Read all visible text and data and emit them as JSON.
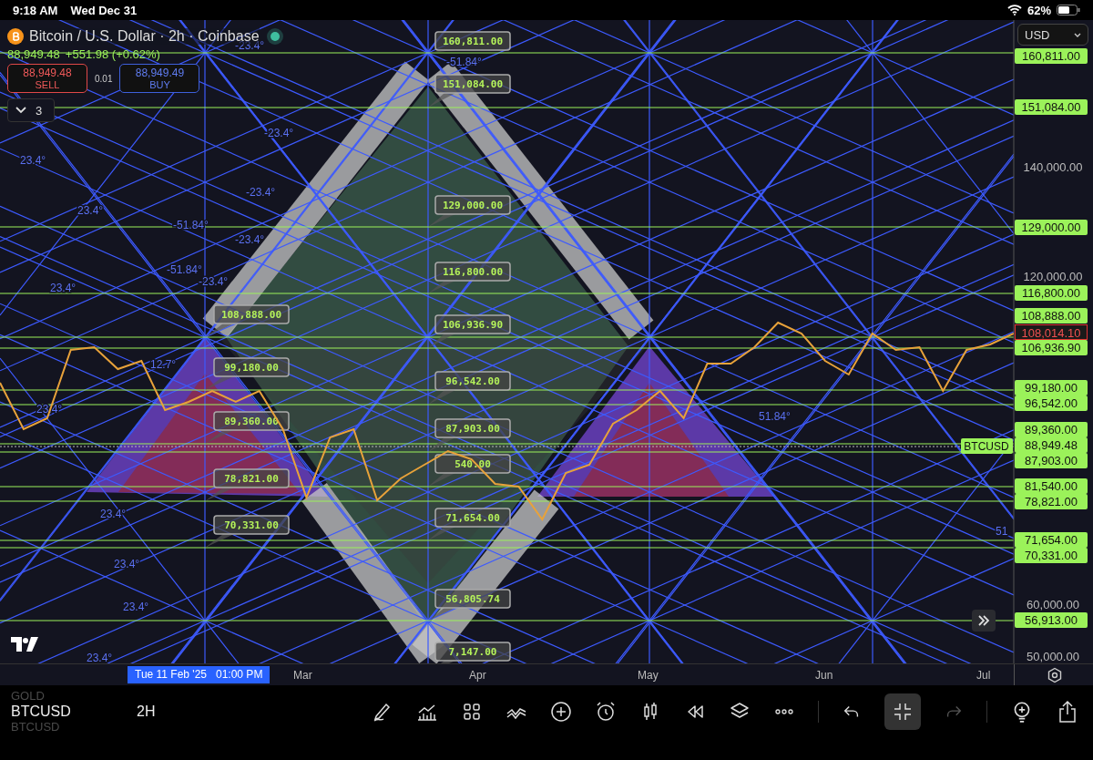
{
  "status_bar": {
    "time": "9:18 AM",
    "date": "Wed Dec 31",
    "battery": "62%"
  },
  "header": {
    "title": "Bitcoin / U.S. Dollar · 2h · Coinbase",
    "last_price": "88,949.48",
    "change": "+551.98 (+0.62%)",
    "sell": {
      "price": "88,949.48",
      "label": "SELL"
    },
    "spread": "0.01",
    "buy": {
      "price": "88,949.49",
      "label": "BUY"
    },
    "indicator_count": "3"
  },
  "currency": "USD",
  "callouts": [
    {
      "text": "160,811.00"
    },
    {
      "text": "151,084.00"
    },
    {
      "text": "129,000.00"
    },
    {
      "text": "116,800.00"
    },
    {
      "text": "106,936.90"
    },
    {
      "text": "96,542.00"
    },
    {
      "text": "87,903.00"
    },
    {
      "text": "540.00"
    },
    {
      "text": "71,654.00"
    },
    {
      "text": "56,805.74"
    },
    {
      "text": "7,147.00"
    },
    {
      "text": "108,888.00"
    },
    {
      "text": "99,180.00"
    },
    {
      "text": "89,360.00"
    },
    {
      "text": "78,821.00"
    },
    {
      "text": "70,331.00"
    }
  ],
  "angle_labels": [
    {
      "text": "-23.4°"
    },
    {
      "text": "-51.84°"
    },
    {
      "text": "-23.4°"
    },
    {
      "text": "23.4°"
    },
    {
      "text": "-23.4°"
    },
    {
      "text": "23.4°"
    },
    {
      "text": "-51.84°"
    },
    {
      "text": "-23.4°"
    },
    {
      "text": "-51.84°"
    },
    {
      "text": "-23.4°"
    },
    {
      "text": "23.4°"
    },
    {
      "text": "12.7°"
    },
    {
      "text": "23.4°"
    },
    {
      "text": "51.84°"
    },
    {
      "text": "23.4°"
    },
    {
      "text": "23.4°"
    },
    {
      "text": "23.4°"
    },
    {
      "text": "23.4°"
    },
    {
      "text": "51"
    }
  ],
  "price_axis": [
    {
      "text": "160,811.00",
      "kind": "level"
    },
    {
      "text": "151,084.00",
      "kind": "level"
    },
    {
      "text": "129,000.00",
      "kind": "level"
    },
    {
      "text": "116,800.00",
      "kind": "level"
    },
    {
      "text": "108,888.00",
      "kind": "level"
    },
    {
      "text": "108,014.10",
      "kind": "current"
    },
    {
      "text": "106,936.90",
      "kind": "level"
    },
    {
      "text": "99,180.00",
      "kind": "level"
    },
    {
      "text": "96,542.00",
      "kind": "level"
    },
    {
      "text": "89,360.00",
      "kind": "level"
    },
    {
      "text": "88,949.48",
      "kind": "level"
    },
    {
      "text": "87,903.00",
      "kind": "level"
    },
    {
      "text": "81,540.00",
      "kind": "level"
    },
    {
      "text": "78,821.00",
      "kind": "level"
    },
    {
      "text": "71,654.00",
      "kind": "level"
    },
    {
      "text": "70,331.00",
      "kind": "level"
    },
    {
      "text": "56,913.00",
      "kind": "level"
    }
  ],
  "price_chart": {
    "chart_data": {
      "type": "line",
      "ylim": [
        45167,
        166833
      ],
      "yticks": [
        {
          "value": 50000,
          "label": "50,000.00"
        },
        {
          "value": 60000,
          "label": "60,000.00"
        },
        {
          "value": 120000,
          "label": "120,000.00"
        },
        {
          "value": 140000,
          "label": "140,000.00"
        }
      ],
      "series": [
        {
          "name": "BTCUSD",
          "color": "#e8a23a",
          "values": [
            100500,
            92000,
            94000,
            106500,
            107000,
            103000,
            104500,
            95500,
            97000,
            99000,
            97000,
            99000,
            92000,
            79500,
            90500,
            92000,
            79000,
            83000,
            85500,
            88000,
            86500,
            82000,
            81500,
            75500,
            84000,
            85500,
            93000,
            95500,
            99000,
            94000,
            104000,
            104000,
            107000,
            111500,
            109500,
            104500,
            102000,
            109500,
            106500,
            107000,
            99000,
            106500,
            107500,
            109500
          ]
        }
      ]
    }
  },
  "time_axis": {
    "crosshair_label": "Tue 11 Feb '25   01:00 PM",
    "months": [
      "Mar",
      "Apr",
      "May",
      "Jun",
      "Jul"
    ]
  },
  "toolbar": {
    "symbols": [
      {
        "text": "GOLD",
        "dimmed": true
      },
      {
        "text": "BTCUSD",
        "dimmed": false
      },
      {
        "text": "BTCUSD",
        "dimmed": true
      }
    ],
    "interval": "2H"
  }
}
